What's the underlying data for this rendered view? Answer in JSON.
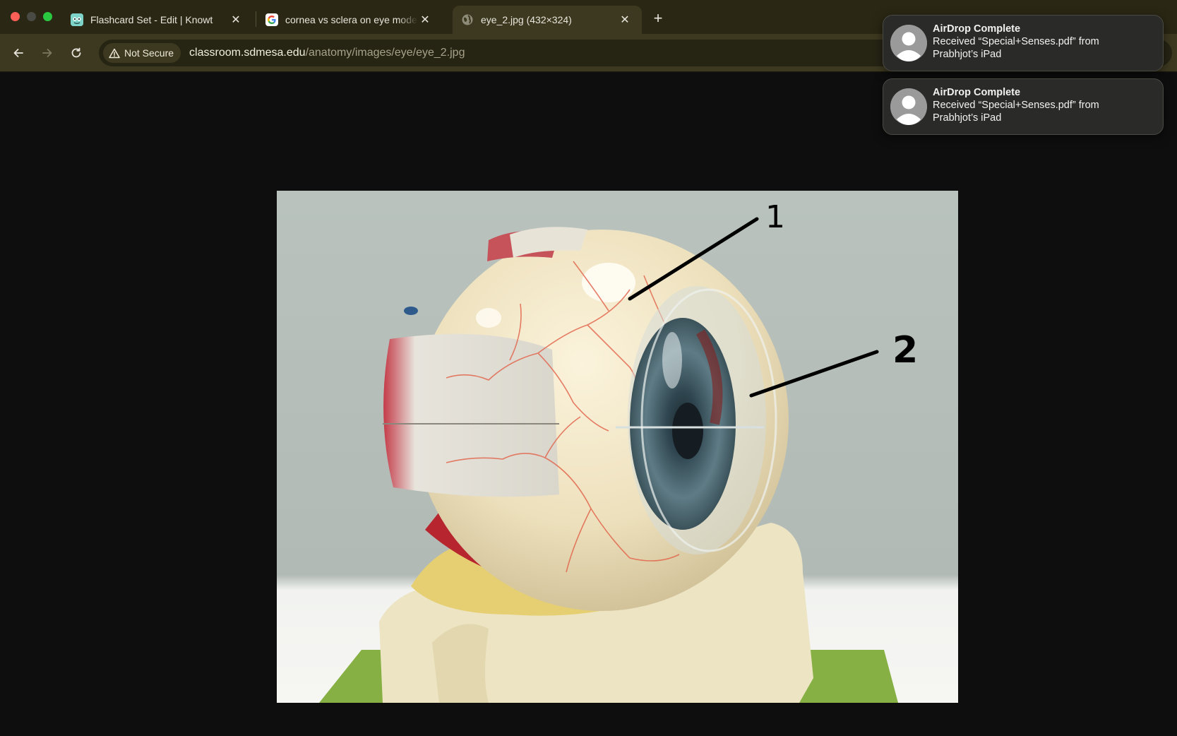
{
  "window": {
    "tabs": [
      {
        "label": "Flashcard Set - Edit | Knowt",
        "icon": "knowt-icon",
        "active": false
      },
      {
        "label": "cornea vs sclera on eye mode",
        "icon": "google-icon",
        "active": false
      },
      {
        "label": "eye_2.jpg (432×324)",
        "icon": "globe-icon",
        "active": true
      }
    ],
    "new_tab_label": "+"
  },
  "toolbar": {
    "security_label": "Not Secure",
    "url_host": "classroom.sdmesa.edu",
    "url_path": "/anatomy/images/eye/eye_2.jpg"
  },
  "image": {
    "annotations": [
      "1",
      "2"
    ]
  },
  "notifications": [
    {
      "title": "AirDrop Complete",
      "body": "Received “Special+Senses.pdf” from Prabhjot’s iPad"
    },
    {
      "title": "AirDrop Complete",
      "body": "Received “Special+Senses.pdf” from Prabhjot’s iPad"
    }
  ],
  "colors": {
    "tab_strip": "#2a2714",
    "toolbar": "#3d3920",
    "page_background": "#0e0e0e"
  }
}
